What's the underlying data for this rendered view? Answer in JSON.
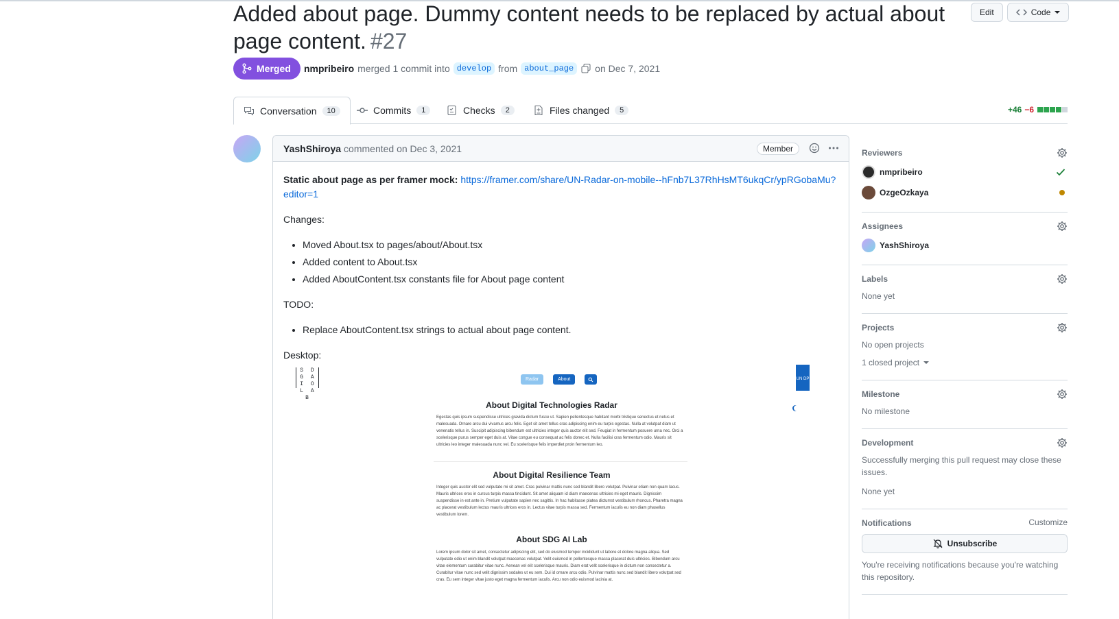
{
  "pr": {
    "title": "Added about page. Dummy content needs to be replaced by actual about page content.",
    "number": "#27",
    "state": "Merged",
    "author": "nmpribeiro",
    "merged_text": "merged 1 commit into",
    "base_branch": "develop",
    "from_text": "from",
    "head_branch": "about_page",
    "date_text": "on Dec 7, 2021"
  },
  "header_actions": {
    "edit": "Edit",
    "code": "Code"
  },
  "tabs": [
    {
      "label": "Conversation",
      "count": "10"
    },
    {
      "label": "Commits",
      "count": "1"
    },
    {
      "label": "Checks",
      "count": "2"
    },
    {
      "label": "Files changed",
      "count": "5"
    }
  ],
  "diffstat": {
    "additions": "+46",
    "deletions": "−6"
  },
  "comment": {
    "author": "YashShiroya",
    "action": "commented on Dec 3, 2021",
    "badge": "Member",
    "intro": "Static about page as per framer mock:",
    "link": "https://framer.com/share/UN-Radar-on-mobile--hFnb7L37RhHsMT6ukqCr/ypRGobaMu?editor=1",
    "changes_heading": "Changes:",
    "changes": [
      "Moved About.tsx to pages/about/About.tsx",
      "Added content to About.tsx",
      "Added AboutContent.tsx constants file for About page content"
    ],
    "todo_heading": "TODO:",
    "todo": [
      "Replace AboutContent.tsx strings to actual about page content."
    ],
    "desktop_heading": "Desktop:"
  },
  "screenshot": {
    "logo": "S D G A I O L A B",
    "nav": [
      "Radar",
      "About"
    ],
    "undp": "UN DP",
    "sections": [
      {
        "title": "About Digital Technologies Radar",
        "text": "Egestas quis ipsum suspendisse ultrices gravida dictum fusce ut. Sapien pellentesque habitant morbi tristique senectus et netus et malesuada. Ornare arcu dui vivamus arcu felis. Eget sit amet tellus cras adipiscing enim eu turpis egestas. Nulla at volutpat diam ut venenatis tellus in. Suscipit adipiscing bibendum est ultricies integer quis auctor elit sed. Feugiat in fermentum posuere urna nec. Orci a scelerisque purus semper eget duis at. Vitae congue eu consequat ac felis donec et. Nulla facilisi cras fermentum odio. Mauris sit ultricies leo integer malesuada nunc vel. Eu scelerisque felis imperdiet proin fermentum leo."
      },
      {
        "title": "About Digital Resilience Team",
        "text": "Integer quis auctor elit sed vulputate mi sit amet. Cras pulvinar mattis nunc sed blandit libero volutpat. Pulvinar etiam non quam lacus. Mauris ultrices eros in cursus turpis massa tincidunt. Sit amet aliquam id diam maecenas ultricies mi eget mauris. Dignissim suspendisse in est ante in. Pretium vulputate sapien nec sagittis. In hac habitasse platea dictumst vestibulum rhoncus. Pharetra magna ac placerat vestibulum lectus mauris ultrices eros in. Lectus vitae turpis massa sed. Fermentum iaculis eu non diam phasellus vestibulum lorem."
      },
      {
        "title": "About SDG AI Lab",
        "text": "Lorem ipsum dolor sit amet, consectetur adipiscing elit, sed do eiusmod tempor incididunt ut labore et dolore magna aliqua. Sed vulputate odio ut enim blandit volutpat maecenas volutpat. Velit euismod in pellentesque massa placerat duis ultricies. Bibendum arcu vitae elementum curabitur vitae nunc. Aenean vel elit scelerisque mauris. Diam erat velit scelerisque in dictum non consectetur a. Curabitur vitae nunc sed velit dignissim sodales ut eu sem. Dui id ornare arcu odio. Pulvinar mattis nunc sed blandit libero volutpat sed cras. Eu sem integer vitae justo eget magna fermentum iaculis. Arcu non odio euismod lacinia at."
      }
    ]
  },
  "sidebar": {
    "reviewers": {
      "heading": "Reviewers",
      "items": [
        {
          "name": "nmpribeiro",
          "status": "approved"
        },
        {
          "name": "OzgeOzkaya",
          "status": "pending"
        }
      ]
    },
    "assignees": {
      "heading": "Assignees",
      "items": [
        "YashShiroya"
      ]
    },
    "labels": {
      "heading": "Labels",
      "value": "None yet"
    },
    "projects": {
      "heading": "Projects",
      "value": "No open projects",
      "closed": "1 closed project"
    },
    "milestone": {
      "heading": "Milestone",
      "value": "No milestone"
    },
    "development": {
      "heading": "Development",
      "text": "Successfully merging this pull request may close these issues.",
      "value": "None yet"
    },
    "notifications": {
      "heading": "Notifications",
      "customize": "Customize",
      "button": "Unsubscribe",
      "text": "You're receiving notifications because you're watching this repository."
    }
  },
  "colors": {
    "merged": "#8250df",
    "link": "#0969da",
    "add": "#1a7f37",
    "del": "#cf222e"
  }
}
